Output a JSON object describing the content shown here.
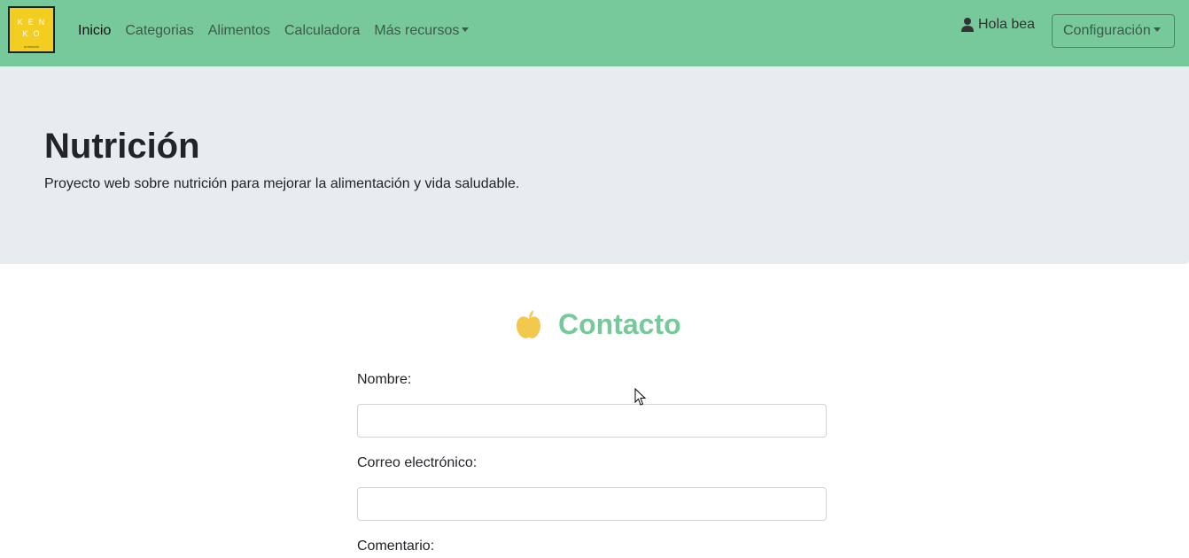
{
  "brand": {
    "logo_text": "KEN KO",
    "logo_subtext": "NUTRICIÓN",
    "logo_color": "#f3cd1f"
  },
  "navbar": {
    "background": "#77c99b",
    "links": [
      {
        "label": "Inicio",
        "active": true
      },
      {
        "label": "Categorias",
        "active": false
      },
      {
        "label": "Alimentos",
        "active": false
      },
      {
        "label": "Calculadora",
        "active": false
      },
      {
        "label": "Más recursos",
        "active": false,
        "dropdown": true
      }
    ],
    "user_greeting": "Hola bea",
    "user_icon": "user-icon",
    "config_label": "Configuración"
  },
  "jumbotron": {
    "title": "Nutrición",
    "lead": "Proyecto web sobre nutrición para mejorar la alimentación y vida saludable."
  },
  "contact": {
    "title": "Contacto",
    "icon": "apple-icon",
    "icon_color": "#f2c94c",
    "title_color": "#77c99b",
    "fields": [
      {
        "label": "Nombre:",
        "value": "",
        "placeholder": ""
      },
      {
        "label": "Correo electrónico:",
        "value": "",
        "placeholder": ""
      },
      {
        "label": "Comentario:"
      }
    ]
  }
}
